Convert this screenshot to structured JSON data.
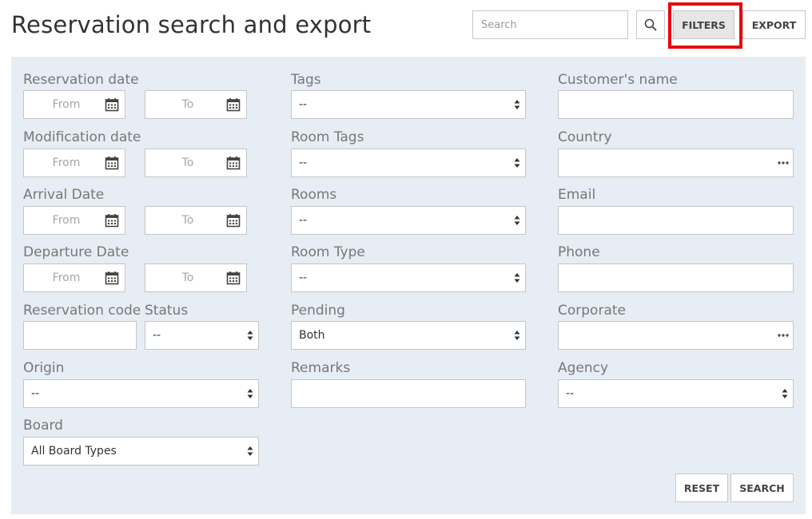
{
  "header": {
    "title": "Reservation search and export",
    "search_placeholder": "Search",
    "filters_label": "FILTERS",
    "export_label": "EXPORT",
    "search_icon": "search-icon"
  },
  "colors": {
    "panel_bg": "#e7edf4",
    "highlight": "#e8080f",
    "filters_active_bg": "#e6e6e6"
  },
  "filters": {
    "reservation_date": {
      "label": "Reservation date",
      "from": "From",
      "to": "To"
    },
    "modification_date": {
      "label": "Modification date",
      "from": "From",
      "to": "To"
    },
    "arrival_date": {
      "label": "Arrival Date",
      "from": "From",
      "to": "To"
    },
    "departure_date": {
      "label": "Departure Date",
      "from": "From",
      "to": "To"
    },
    "reservation_code": {
      "label": "Reservation code",
      "value": ""
    },
    "status": {
      "label": "Status",
      "value": "--"
    },
    "origin": {
      "label": "Origin",
      "value": "--"
    },
    "board": {
      "label": "Board",
      "value": "All Board Types"
    },
    "tags": {
      "label": "Tags",
      "value": "--"
    },
    "room_tags": {
      "label": "Room Tags",
      "value": "--"
    },
    "rooms": {
      "label": "Rooms",
      "value": "--"
    },
    "room_type": {
      "label": "Room Type",
      "value": "--"
    },
    "pending": {
      "label": "Pending",
      "value": "Both"
    },
    "remarks": {
      "label": "Remarks",
      "value": ""
    },
    "customer_name": {
      "label": "Customer's name",
      "value": ""
    },
    "country": {
      "label": "Country",
      "value": ""
    },
    "email": {
      "label": "Email",
      "value": ""
    },
    "phone": {
      "label": "Phone",
      "value": ""
    },
    "corporate": {
      "label": "Corporate",
      "value": ""
    },
    "agency": {
      "label": "Agency",
      "value": "--"
    }
  },
  "actions": {
    "reset_label": "RESET",
    "search_label": "SEARCH"
  }
}
